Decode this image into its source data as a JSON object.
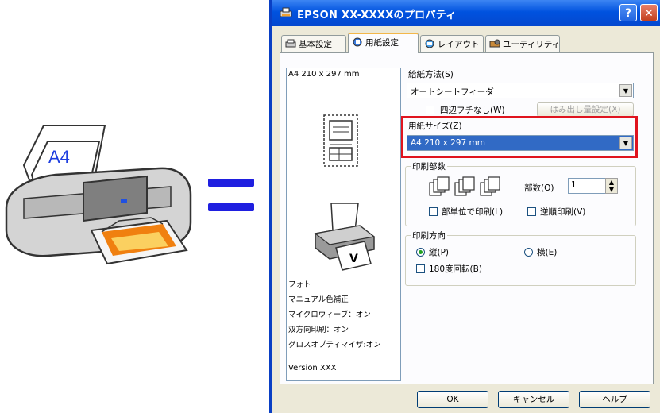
{
  "illustration": {
    "paper_label": "A4"
  },
  "dialog": {
    "title": "EPSON XX-XXXXのプロパティ",
    "help_glyph": "?",
    "close_glyph": "✕",
    "tabs": [
      {
        "label": "基本設定"
      },
      {
        "label": "用紙設定"
      },
      {
        "label": "レイアウト"
      },
      {
        "label": "ユーティリティ"
      }
    ],
    "preview": {
      "paper_size": "A4 210 x 297 mm",
      "settings_lines": [
        "フォト",
        "マニュアル色補正",
        "マイクロウィーブ：オン",
        "双方向印刷：オン",
        "グロスオプティマイザ:オン"
      ],
      "version": "Version XXX"
    },
    "paper_source": {
      "label": "給紙方法(S)",
      "value": "オートシートフィーダ"
    },
    "borderless": {
      "label": "四辺フチなし(W)",
      "overflow_button": "はみ出し量設定(X)"
    },
    "paper_size": {
      "label": "用紙サイズ(Z)",
      "value": "A4 210 x 297 mm"
    },
    "copies_group": {
      "title": "印刷部数",
      "copies_label": "部数(O)",
      "copies_value": "1",
      "collate_label": "部単位で印刷(L)",
      "reverse_label": "逆順印刷(V)"
    },
    "orientation_group": {
      "title": "印刷方向",
      "portrait_label": "縦(P)",
      "landscape_label": "横(E)",
      "rotate_label": "180度回転(B)"
    },
    "buttons": {
      "ok": "OK",
      "cancel": "キャンセル",
      "help": "ヘルプ"
    },
    "highlight_color": "#e0141e",
    "accent_color": "#0052df"
  }
}
